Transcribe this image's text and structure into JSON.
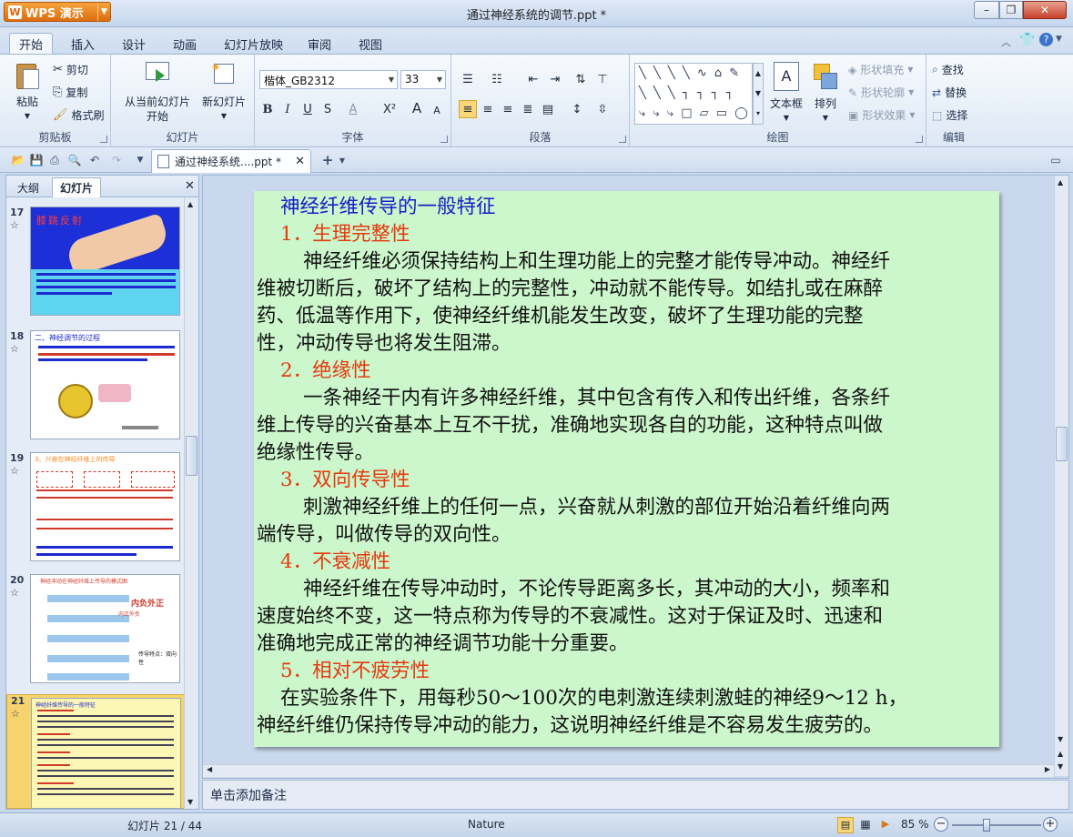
{
  "app": {
    "name": "WPS 演示",
    "window_title": "通过神经系统的调节.ppt *"
  },
  "ribbon_tabs": [
    "开始",
    "插入",
    "设计",
    "动画",
    "幻灯片放映",
    "审阅",
    "视图"
  ],
  "clipboard": {
    "paste": "粘贴",
    "cut": "剪切",
    "copy": "复制",
    "format_painter": "格式刷",
    "group": "剪贴板"
  },
  "slides_group": {
    "from_current": "从当前幻灯片",
    "from_current2": "开始",
    "new_slide": "新幻灯片",
    "group": "幻灯片"
  },
  "font_group": {
    "font_name": "楷体_GB2312",
    "font_size": "33",
    "bold": "B",
    "italic": "I",
    "underline": "U",
    "strike": "S",
    "font_color": "A",
    "superscript": "X²",
    "grow": "A",
    "shrink": "A",
    "group": "字体"
  },
  "paragraph_group": {
    "group": "段落"
  },
  "drawing_group": {
    "textbox": "文本框",
    "arrange": "排列",
    "fill": "形状填充",
    "outline": "形状轮廓",
    "effect": "形状效果",
    "group": "绘图"
  },
  "edit_group": {
    "find": "查找",
    "replace": "替换",
    "select": "选择",
    "group": "编辑"
  },
  "doc_tab": {
    "label": "通过神经系统....ppt *"
  },
  "left_panel": {
    "tab_outline": "大纲",
    "tab_slides": "幻灯片"
  },
  "thumbnails": [
    {
      "num": "17",
      "title": "膝跳反射"
    },
    {
      "num": "18",
      "title": "二、神经调节的过程"
    },
    {
      "num": "19",
      "title": "3、兴奋在神经纤维上的传导"
    },
    {
      "num": "20",
      "title": "神经冲动在神经纤维上传导的模式图",
      "callout1": "内负外正",
      "callout2": "内正外负",
      "callout3": "传导特点：双向性"
    },
    {
      "num": "21",
      "title": "神经纤维传导的一般特征"
    }
  ],
  "slide": {
    "title": "神经纤维传导的一般特征",
    "h1": "1．生理完整性",
    "p1": [
      "神经纤维必须保持结构上和生理功能上的完整才能传导冲动。神经纤",
      "维被切断后，破坏了结构上的完整性，冲动就不能传导。如结扎或在麻醉",
      "药、低温等作用下，使神经纤维机能发生改变，破坏了生理功能的完整",
      "性，冲动传导也将发生阻滞。"
    ],
    "h2": "2．绝缘性",
    "p2": [
      "一条神经干内有许多神经纤维，其中包含有传入和传出纤维，各条纤",
      "维上传导的兴奋基本上互不干扰，准确地实现各自的功能，这种特点叫做",
      "绝缘性传导。"
    ],
    "h3": "3．双向传导性",
    "p3": [
      "刺激神经纤维上的任何一点，兴奋就从刺激的部位开始沿着纤维向两",
      "端传导，叫做传导的双向性。"
    ],
    "h4": "4．不衰减性",
    "p4": [
      "神经纤维在传导冲动时，不论传导距离多长，其冲动的大小，频率和",
      "速度始终不变，这一特点称为传导的不衰减性。这对于保证及时、迅速和",
      "准确地完成正常的神经调节功能十分重要。"
    ],
    "h5": "5．相对不疲劳性",
    "p5": [
      "在实验条件下，用每秒50～100次的电刺激连续刺激蛙的神经9～12 h，",
      "神经纤维仍保持传导冲动的能力，这说明神经纤维是不容易发生疲劳的。"
    ]
  },
  "notes_placeholder": "单击添加备注",
  "status": {
    "slide_pos": "幻灯片 21 / 44",
    "theme": "Nature",
    "zoom": "85 %"
  }
}
